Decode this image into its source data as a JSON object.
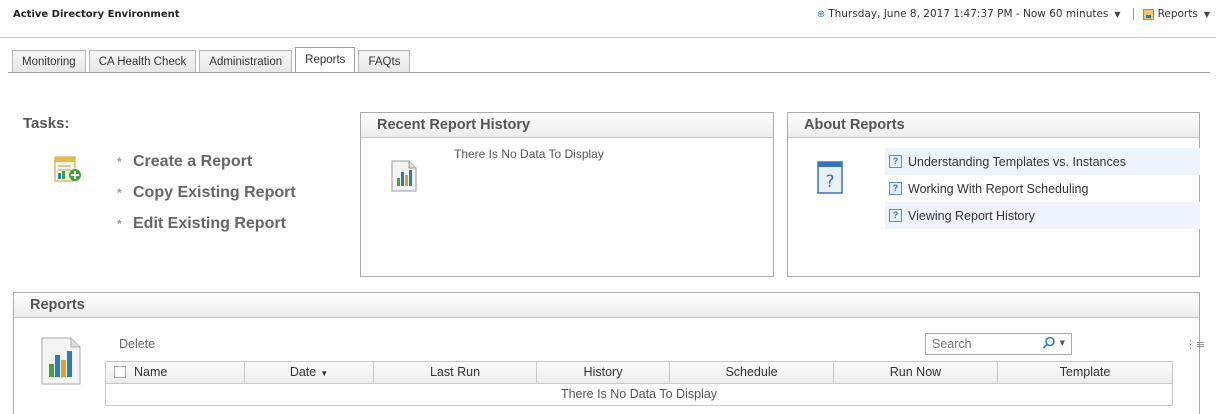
{
  "app": {
    "title": "Active Directory Environment",
    "timestamp": "Thursday, June 8, 2017 1:47:37 PM - Now 60 minutes",
    "reports_menu": "Reports"
  },
  "tabs": [
    {
      "label": "Monitoring"
    },
    {
      "label": "CA Health Check"
    },
    {
      "label": "Administration"
    },
    {
      "label": "Reports",
      "active": true
    },
    {
      "label": "FAQts"
    }
  ],
  "tasks": {
    "title": "Tasks:",
    "items": [
      "Create a Report",
      "Copy Existing Report",
      "Edit Existing Report"
    ]
  },
  "recent_history": {
    "title": "Recent Report History",
    "empty": "There Is No Data To Display"
  },
  "about": {
    "title": "About Reports",
    "links": [
      "Understanding Templates vs. Instances",
      "Working With Report Scheduling",
      "Viewing Report History"
    ]
  },
  "reports": {
    "title": "Reports",
    "delete_label": "Delete",
    "search_placeholder": "Search",
    "columns": [
      "Name",
      "Date",
      "Last Run",
      "History",
      "Schedule",
      "Run Now",
      "Template"
    ],
    "empty": "There Is No Data To Display"
  },
  "colors": {
    "accent": "#2a7cc2",
    "border": "#aaaaaa"
  }
}
